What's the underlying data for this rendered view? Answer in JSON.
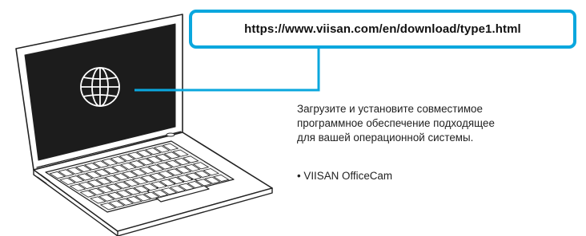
{
  "url": "https://www.viisan.com/en/download/type1.html",
  "description_lines": [
    "Загрузите и установите совместимое",
    "программное обеспечение подходящее",
    "для вашей операционной системы."
  ],
  "software_item": "• VIISAN OfficeCam",
  "icons": {
    "laptop": "laptop-icon",
    "globe": "globe-icon"
  },
  "colors": {
    "accent": "#0aa7de",
    "screen": "#1c1c1c"
  }
}
